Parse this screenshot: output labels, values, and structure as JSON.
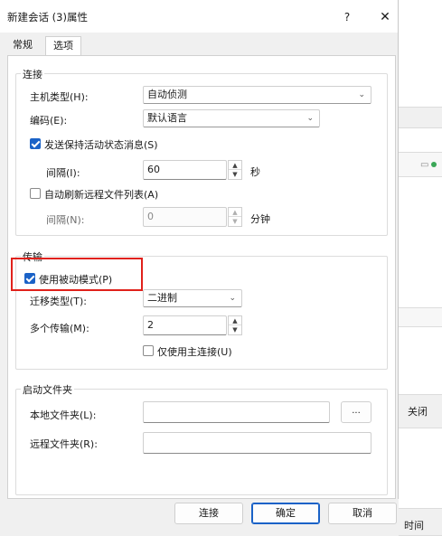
{
  "dialog": {
    "title": "新建会话 (3)属性",
    "help_label": "?",
    "close_label": "✕"
  },
  "tabs": [
    {
      "label": "常规",
      "active": false
    },
    {
      "label": "选项",
      "active": true
    }
  ],
  "connection": {
    "group_label": "连接",
    "host_type_label": "主机类型(H):",
    "host_type_value": "自动侦测",
    "encoding_label": "编码(E):",
    "encoding_value": "默认语言",
    "keepalive_label": "发送保持活动状态消息(S)",
    "keepalive_checked": true,
    "interval_label": "间隔(I):",
    "interval_value": "60",
    "interval_unit": "秒",
    "auto_refresh_label": "自动刷新远程文件列表(A)",
    "auto_refresh_checked": false,
    "refresh_interval_label": "间隔(N):",
    "refresh_interval_value": "0",
    "refresh_interval_unit": "分钟"
  },
  "transfer": {
    "group_label": "传输",
    "passive_label": "使用被动模式(P)",
    "passive_checked": true,
    "transfer_type_label": "迁移类型(T):",
    "transfer_type_value": "二进制",
    "multi_transfer_label": "多个传输(M):",
    "multi_transfer_value": "2",
    "main_only_label": "仅使用主连接(U)",
    "main_only_checked": false
  },
  "startup": {
    "group_label": "启动文件夹",
    "local_label": "本地文件夹(L):",
    "local_value": "",
    "browse_label": "...",
    "remote_label": "远程文件夹(R):",
    "remote_value": ""
  },
  "footer": {
    "connect_label": "连接",
    "ok_label": "确定",
    "cancel_label": "取消"
  },
  "background": {
    "close_label": "关闭",
    "bottom_text": "时间"
  },
  "colors": {
    "accent": "#1a62c7",
    "highlight": "#e0211b"
  }
}
